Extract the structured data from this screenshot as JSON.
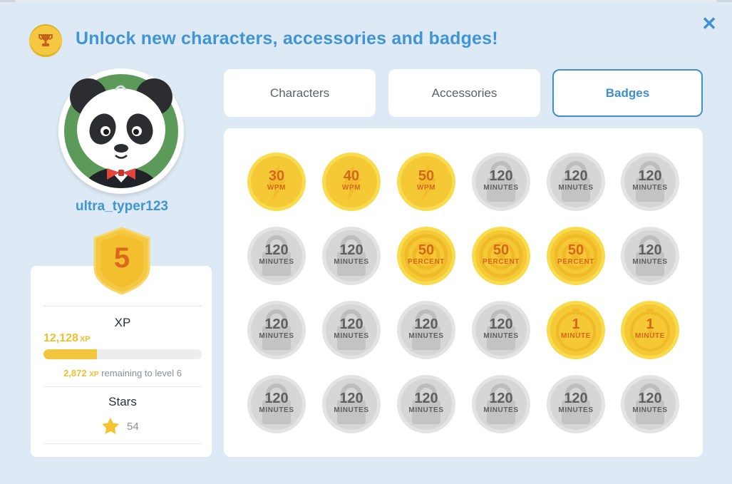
{
  "header": {
    "title": "Unlock new characters, accessories and badges!"
  },
  "close_icon": "close-icon",
  "profile": {
    "username": "ultra_typer123",
    "level": "5",
    "xp_label": "XP",
    "xp_value": "12,128",
    "xp_unit": "XP",
    "xp_progress_fraction": 0.34,
    "remaining_value": "2,872",
    "remaining_unit": "XP",
    "remaining_text": "remaining to level 6",
    "stars_label": "Stars",
    "stars_count": "54"
  },
  "tabs": [
    {
      "label": "Characters",
      "active": false
    },
    {
      "label": "Accessories",
      "active": false
    },
    {
      "label": "Badges",
      "active": true
    }
  ],
  "badges": [
    {
      "value": "30",
      "unit": "WPM",
      "earned": true,
      "icon": "lightning-icon"
    },
    {
      "value": "40",
      "unit": "WPM",
      "earned": true,
      "icon": "lightning-icon"
    },
    {
      "value": "50",
      "unit": "WPM",
      "earned": true,
      "icon": "lightning-icon"
    },
    {
      "value": "120",
      "unit": "MINUTES",
      "earned": false,
      "icon": "lock-icon"
    },
    {
      "value": "120",
      "unit": "MINUTES",
      "earned": false,
      "icon": "lock-icon"
    },
    {
      "value": "120",
      "unit": "MINUTES",
      "earned": false,
      "icon": "lock-icon"
    },
    {
      "value": "120",
      "unit": "MINUTES",
      "earned": false,
      "icon": "lock-icon"
    },
    {
      "value": "120",
      "unit": "MINUTES",
      "earned": false,
      "icon": "lock-icon"
    },
    {
      "value": "50",
      "unit": "PERCENT",
      "earned": true,
      "icon": "target-icon"
    },
    {
      "value": "50",
      "unit": "PERCENT",
      "earned": true,
      "icon": "target-icon"
    },
    {
      "value": "50",
      "unit": "PERCENT",
      "earned": true,
      "icon": "target-icon"
    },
    {
      "value": "120",
      "unit": "MINUTES",
      "earned": false,
      "icon": "lock-icon"
    },
    {
      "value": "120",
      "unit": "MINUTES",
      "earned": false,
      "icon": "lock-icon"
    },
    {
      "value": "120",
      "unit": "MINUTES",
      "earned": false,
      "icon": "lock-icon"
    },
    {
      "value": "120",
      "unit": "MINUTES",
      "earned": false,
      "icon": "lock-icon"
    },
    {
      "value": "120",
      "unit": "MINUTES",
      "earned": false,
      "icon": "lock-icon"
    },
    {
      "value": "1",
      "unit": "MINUTE",
      "earned": true,
      "icon": "clock-icon"
    },
    {
      "value": "1",
      "unit": "MINUTE",
      "earned": true,
      "icon": "clock-icon"
    },
    {
      "value": "120",
      "unit": "MINUTES",
      "earned": false,
      "icon": "lock-icon"
    },
    {
      "value": "120",
      "unit": "MINUTES",
      "earned": false,
      "icon": "lock-icon"
    },
    {
      "value": "120",
      "unit": "MINUTES",
      "earned": false,
      "icon": "lock-icon"
    },
    {
      "value": "120",
      "unit": "MINUTES",
      "earned": false,
      "icon": "lock-icon"
    },
    {
      "value": "120",
      "unit": "MINUTES",
      "earned": false,
      "icon": "lock-icon"
    },
    {
      "value": "120",
      "unit": "MINUTES",
      "earned": false,
      "icon": "lock-icon"
    }
  ],
  "colors": {
    "accent": "#3f95d6",
    "gold": "#f5c842",
    "badge_text_earned": "#d5671b",
    "locked": "#d9d9d9"
  }
}
